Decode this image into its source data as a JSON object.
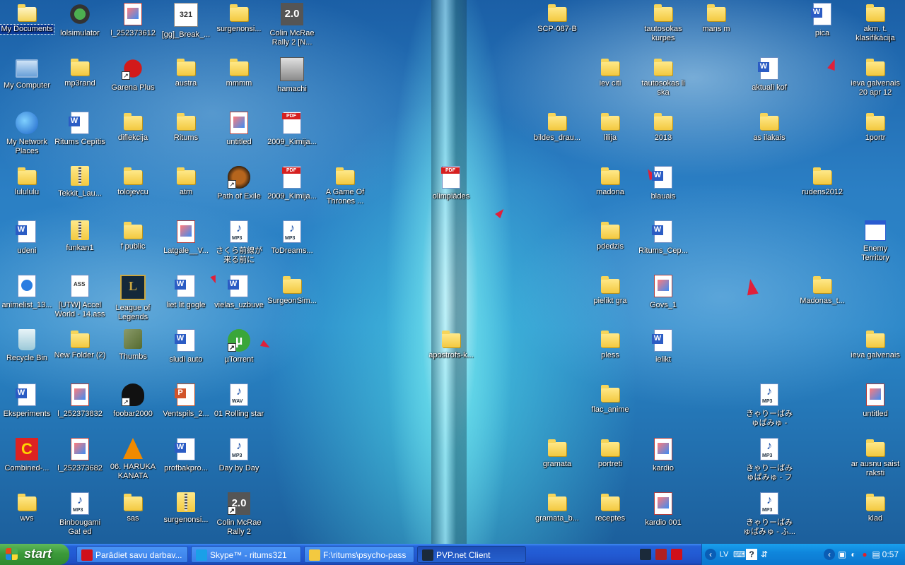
{
  "desktop": {
    "icons": [
      {
        "label": "My Documents",
        "type": "mydocs",
        "selected": true
      },
      {
        "label": "lolsimulator",
        "type": "gear"
      },
      {
        "label": "l_252373612",
        "type": "image"
      },
      {
        "label": "[gg]_Break_...",
        "type": "mediaclassic"
      },
      {
        "label": "surgenonsi...",
        "type": "folder"
      },
      {
        "label": "Colin McRae Rally 2 [N...",
        "type": "cmr"
      },
      {
        "label": "My Computer",
        "type": "mycomputer"
      },
      {
        "label": "mp3rand",
        "type": "folder"
      },
      {
        "label": "Garena Plus",
        "type": "garena",
        "shortcut": true
      },
      {
        "label": "austra",
        "type": "folder"
      },
      {
        "label": "mmmm",
        "type": "folder"
      },
      {
        "label": "hamachi",
        "type": "installer"
      },
      {
        "label": "My Network Places",
        "type": "network"
      },
      {
        "label": "Ritums Cepītis",
        "type": "word"
      },
      {
        "label": "diflekcija",
        "type": "folder"
      },
      {
        "label": "Ritums",
        "type": "folder"
      },
      {
        "label": "untitled",
        "type": "image"
      },
      {
        "label": "2009_Kimija...",
        "type": "pdf"
      },
      {
        "label": "lulululu",
        "type": "folder"
      },
      {
        "label": "Tekkit_Lau...",
        "type": "zip"
      },
      {
        "label": "tolojevcu",
        "type": "folder"
      },
      {
        "label": "atm",
        "type": "folder"
      },
      {
        "label": "Path of Exile",
        "type": "poe",
        "shortcut": true
      },
      {
        "label": "2009_Kimija...",
        "type": "pdf"
      },
      {
        "label": "A Game Of Thrones ...",
        "type": "folder"
      },
      {
        "label": "udeni",
        "type": "word"
      },
      {
        "label": "funkan1",
        "type": "zip"
      },
      {
        "label": "f public",
        "type": "folder"
      },
      {
        "label": "Latgale__V...",
        "type": "image"
      },
      {
        "label": "さくら前線が来る前に",
        "type": "mp3"
      },
      {
        "label": "ToDreams...",
        "type": "mp3"
      },
      {
        "label": "animelist_13...",
        "type": "web"
      },
      {
        "label": "[UTW] Accel World - 14.ass",
        "type": "textfile"
      },
      {
        "label": "League of Legends",
        "type": "lol"
      },
      {
        "label": "liet lit gogle",
        "type": "word"
      },
      {
        "label": "vielas_uzbuve",
        "type": "word"
      },
      {
        "label": "SurgeonSim...",
        "type": "folder"
      },
      {
        "label": "Recycle Bin",
        "type": "recycle"
      },
      {
        "label": "New Folder (2)",
        "type": "folder"
      },
      {
        "label": "Thumbs",
        "type": "thumbs"
      },
      {
        "label": "sludi auto",
        "type": "word"
      },
      {
        "label": "µTorrent",
        "type": "utorrent",
        "shortcut": true
      },
      {
        "label": "Eksperiments",
        "type": "word"
      },
      {
        "label": "l_252373832",
        "type": "image"
      },
      {
        "label": "foobar2000",
        "type": "foobar",
        "shortcut": true
      },
      {
        "label": "Ventspils_2...",
        "type": "ppt"
      },
      {
        "label": "01 Rolling star",
        "type": "wav"
      },
      {
        "label": "Combined-...",
        "type": "combined"
      },
      {
        "label": "l_252373682",
        "type": "image"
      },
      {
        "label": "06. HARUKA KANATA",
        "type": "vlc"
      },
      {
        "label": "profbakpro...",
        "type": "word"
      },
      {
        "label": "Day by Day",
        "type": "mp3"
      },
      {
        "label": "wvs",
        "type": "folder"
      },
      {
        "label": "Binbougami Ga! ed",
        "type": "mp3"
      },
      {
        "label": "sas",
        "type": "folder"
      },
      {
        "label": "surgenonsi...",
        "type": "zip"
      },
      {
        "label": "Colin McRae Rally 2",
        "type": "cmr",
        "shortcut": true
      },
      {
        "label": "SCP-087-B",
        "type": "folder"
      },
      {
        "label": "tautosokas kurpes",
        "type": "folder"
      },
      {
        "label": "mans m",
        "type": "folder"
      },
      {
        "label": "pica",
        "type": "word"
      },
      {
        "label": "akm. t. klasifikācija",
        "type": "folder"
      },
      {
        "label": "iev citi",
        "type": "folder"
      },
      {
        "label": "tautosokas li ska",
        "type": "folder"
      },
      {
        "label": "aktuali kof",
        "type": "word"
      },
      {
        "label": "ieva galvenais 20 apr 12",
        "type": "folder"
      },
      {
        "label": "bildes_drau...",
        "type": "folder"
      },
      {
        "label": "lilija",
        "type": "folder"
      },
      {
        "label": "2013",
        "type": "folder"
      },
      {
        "label": "as ilakais",
        "type": "folder"
      },
      {
        "label": "1portr",
        "type": "folder"
      },
      {
        "label": "olimpiādes",
        "type": "pdf"
      },
      {
        "label": "madona",
        "type": "folder"
      },
      {
        "label": "blauais",
        "type": "word"
      },
      {
        "label": "rudens2012",
        "type": "folder"
      },
      {
        "label": "pdedzis",
        "type": "folder"
      },
      {
        "label": "Ritums_Cep...",
        "type": "word"
      },
      {
        "label": "Enemy Territory",
        "type": "app"
      },
      {
        "label": "pielikt gra",
        "type": "folder"
      },
      {
        "label": "Govs_1",
        "type": "image"
      },
      {
        "label": "Madonas_t...",
        "type": "folder"
      },
      {
        "label": "apostrofs-k...",
        "type": "folder"
      },
      {
        "label": "pless",
        "type": "folder"
      },
      {
        "label": "ielikt",
        "type": "word"
      },
      {
        "label": "ieva galvenais",
        "type": "folder"
      },
      {
        "label": "flac_anime",
        "type": "folder"
      },
      {
        "label": "きゃりーぱみゅぱみゅ - CA...",
        "type": "mp3"
      },
      {
        "label": "untitled",
        "type": "image"
      },
      {
        "label": "gramata",
        "type": "folder"
      },
      {
        "label": "portreti",
        "type": "folder"
      },
      {
        "label": "kardio",
        "type": "image"
      },
      {
        "label": "きゃりーぱみゅぱみゅ - ファ...",
        "type": "mp3"
      },
      {
        "label": "ar ausnu saist raksti",
        "type": "folder"
      },
      {
        "label": "gramata_b...",
        "type": "folder"
      },
      {
        "label": "receptes",
        "type": "folder"
      },
      {
        "label": "kardio 001",
        "type": "image"
      },
      {
        "label": "きゃりーぱみゅぱみゅ - ふ...",
        "type": "mp3"
      },
      {
        "label": "klad",
        "type": "folder"
      }
    ]
  },
  "taskbar": {
    "start_label": "start",
    "tasks": [
      {
        "label": "Parādiet savu darbav...",
        "icon": "opera-icon",
        "color": "#d0101a"
      },
      {
        "label": "Skype™ - ritums321",
        "icon": "skype-icon",
        "color": "#1aa0e8"
      },
      {
        "label": "F:\\ritums\\psycho-pass",
        "icon": "folder-icon",
        "color": "#f3c940"
      },
      {
        "label": "PVP.net Client",
        "icon": "lol-icon",
        "color": "#1b2a3a",
        "active": true
      }
    ],
    "quick_launch": [
      {
        "icon": "lol-icon",
        "color": "#1b2a3a"
      },
      {
        "icon": "app-icon",
        "color": "#b02020"
      },
      {
        "icon": "opera-icon",
        "color": "#d0101a"
      }
    ],
    "language": "LV",
    "clock": "0:57"
  }
}
